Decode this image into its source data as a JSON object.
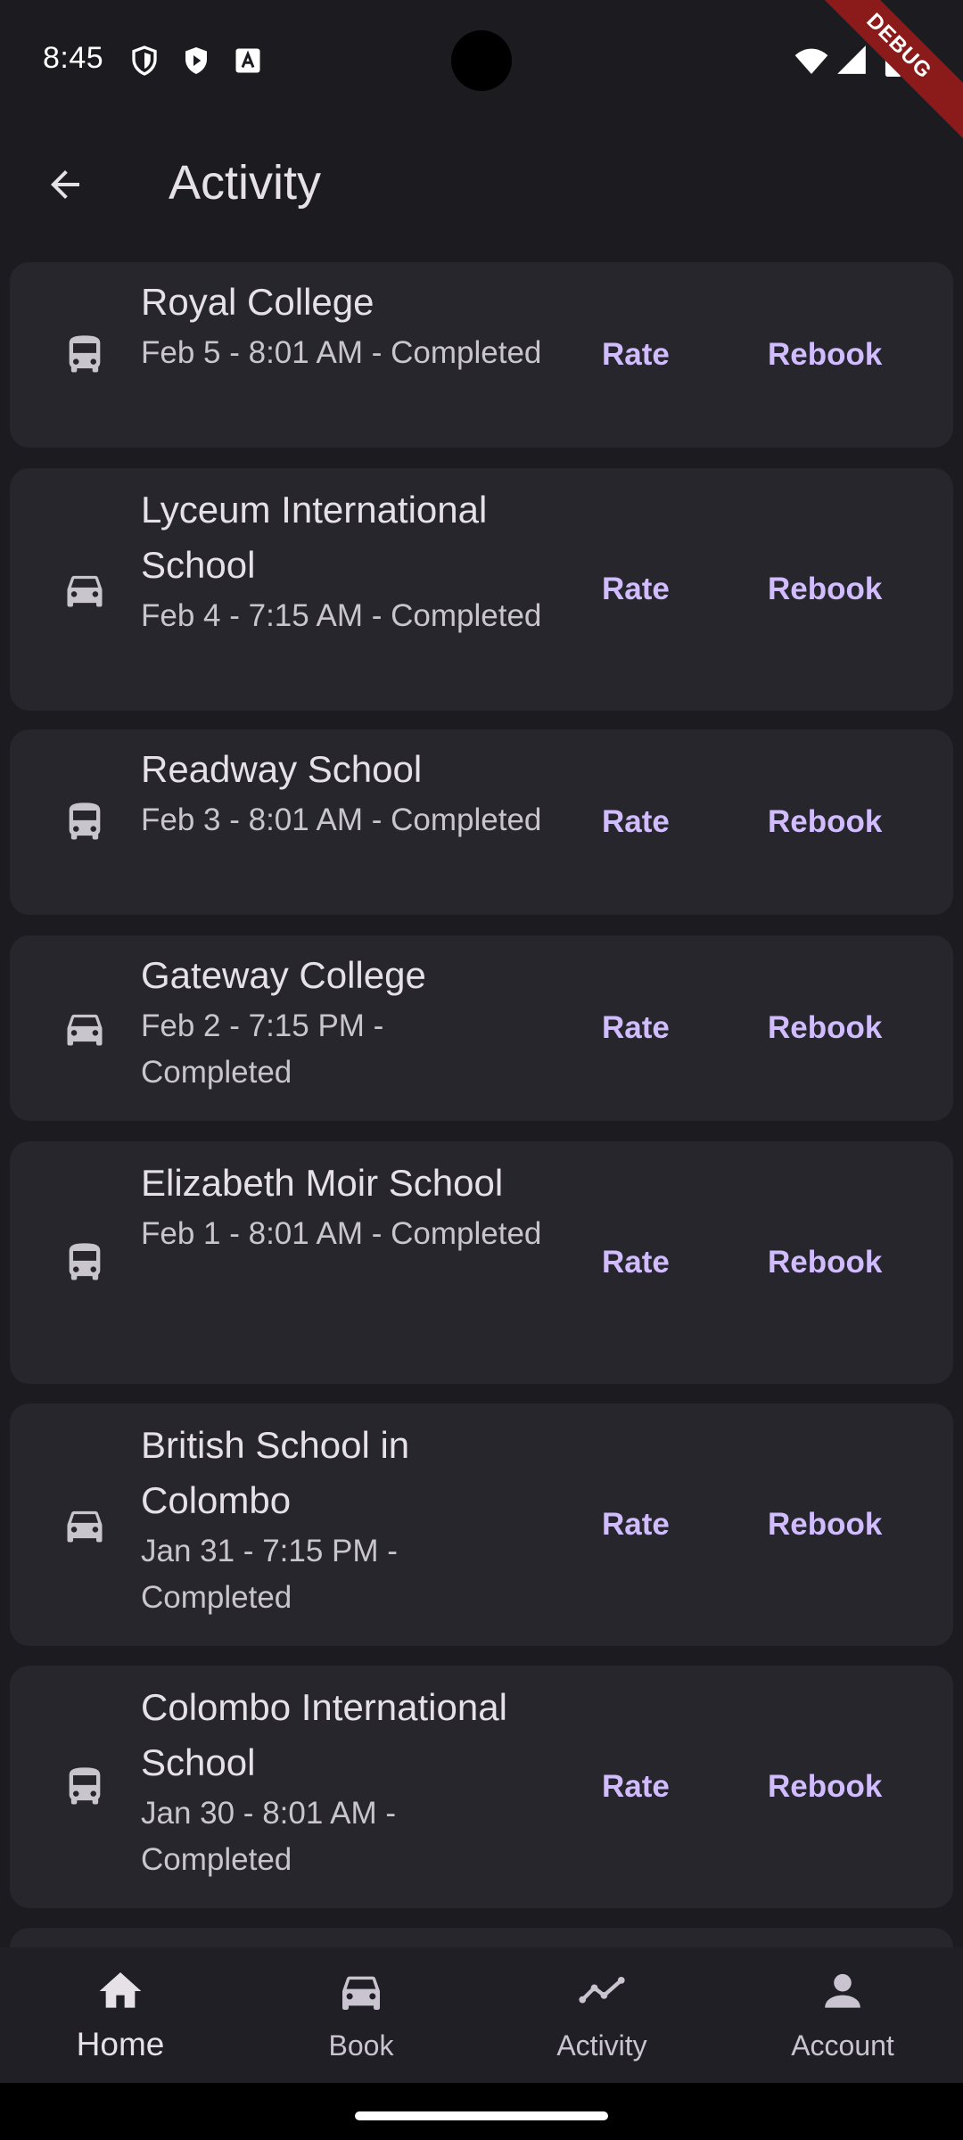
{
  "status_bar": {
    "time": "8:45",
    "icons": [
      "shield-icon",
      "play-protect-icon",
      "font-icon",
      "wifi-icon",
      "signal-icon",
      "battery-icon"
    ],
    "debug_label": "DEBUG"
  },
  "app_bar": {
    "title": "Activity",
    "back_icon": "arrow-back-icon"
  },
  "colors": {
    "background": "#1c1b20",
    "card": "#27262c",
    "accent": "#d0bcff",
    "debug_ribbon": "#8b1a1a"
  },
  "activities": [
    {
      "icon": "bus-icon",
      "title": "Royal College",
      "subtitle": "Feb 5 - 8:01 AM - Completed",
      "rate_label": "Rate",
      "rebook_label": "Rebook"
    },
    {
      "icon": "car-icon",
      "title": "Lyceum International School",
      "subtitle": "Feb 4 - 7:15 AM - Completed",
      "rate_label": "Rate",
      "rebook_label": "Rebook"
    },
    {
      "icon": "bus-icon",
      "title": "Readway School",
      "subtitle": "Feb 3 - 8:01 AM - Completed",
      "rate_label": "Rate",
      "rebook_label": "Rebook"
    },
    {
      "icon": "car-icon",
      "title": "Gateway College",
      "subtitle": "Feb 2 - 7:15 PM - Completed",
      "rate_label": "Rate",
      "rebook_label": "Rebook"
    },
    {
      "icon": "bus-icon",
      "title": "Elizabeth Moir School",
      "subtitle": "Feb 1 - 8:01 AM - Completed",
      "rate_label": "Rate",
      "rebook_label": "Rebook"
    },
    {
      "icon": "car-icon",
      "title": "British School in Colombo",
      "subtitle": "Jan 31 - 7:15 PM - Completed",
      "rate_label": "Rate",
      "rebook_label": "Rebook"
    },
    {
      "icon": "bus-icon",
      "title": "Colombo International School",
      "subtitle": "Jan 30 - 8:01 AM - Completed",
      "rate_label": "Rate",
      "rebook_label": "Rebook"
    }
  ],
  "bottom_nav": {
    "items": [
      {
        "label": "Home",
        "icon": "home-icon",
        "active": true
      },
      {
        "label": "Book",
        "icon": "car-icon",
        "active": false
      },
      {
        "label": "Activity",
        "icon": "activity-icon",
        "active": false
      },
      {
        "label": "Account",
        "icon": "account-icon",
        "active": false
      }
    ]
  }
}
